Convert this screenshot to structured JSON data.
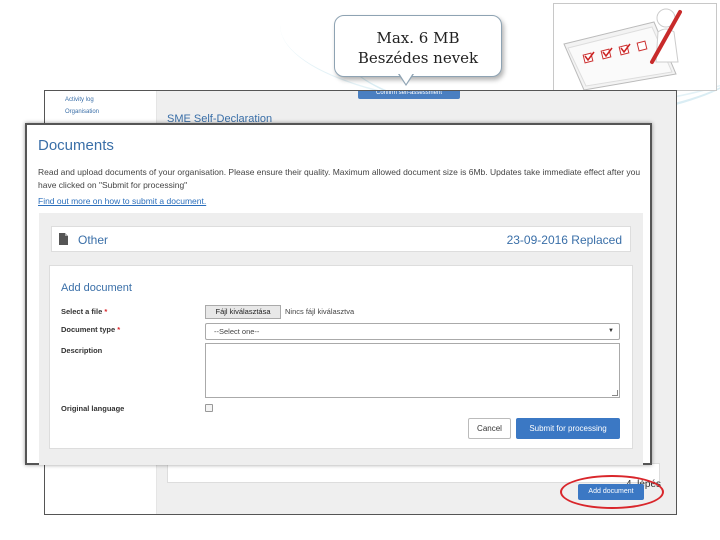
{
  "callout": {
    "line1": "Max. 6 MB",
    "line2": "Beszédes nevek"
  },
  "background_app": {
    "sidebar_items": [
      "Activity log",
      "Organisation"
    ],
    "top_button": "Confirm self-assessment",
    "section_heading": "SME Self-Declaration",
    "step_label": "4. lépés",
    "add_document_button": "Add document"
  },
  "modal": {
    "title": "Documents",
    "description": "Read and upload documents of your organisation. Please ensure their quality. Maximum allowed document size is 6Mb. Updates take immediate effect after you have clicked on \"Submit for processing\"",
    "help_link": "Find out more on how to submit a document.",
    "document": {
      "name": "Other",
      "date_status": "23-09-2016 Replaced"
    },
    "form": {
      "title": "Add document",
      "select_file_label": "Select a file",
      "select_file_required": "*",
      "file_button": "Fájl kiválasztása",
      "file_none": "Nincs fájl kiválasztva",
      "document_type_label": "Document type",
      "document_type_required": "*",
      "document_type_value": "--Select one--",
      "description_label": "Description",
      "original_language_label": "Original language",
      "cancel_button": "Cancel",
      "submit_button": "Submit for processing"
    }
  },
  "colors": {
    "accent": "#3b78c4",
    "heading": "#3a6fa8",
    "highlight": "#d9262b"
  }
}
